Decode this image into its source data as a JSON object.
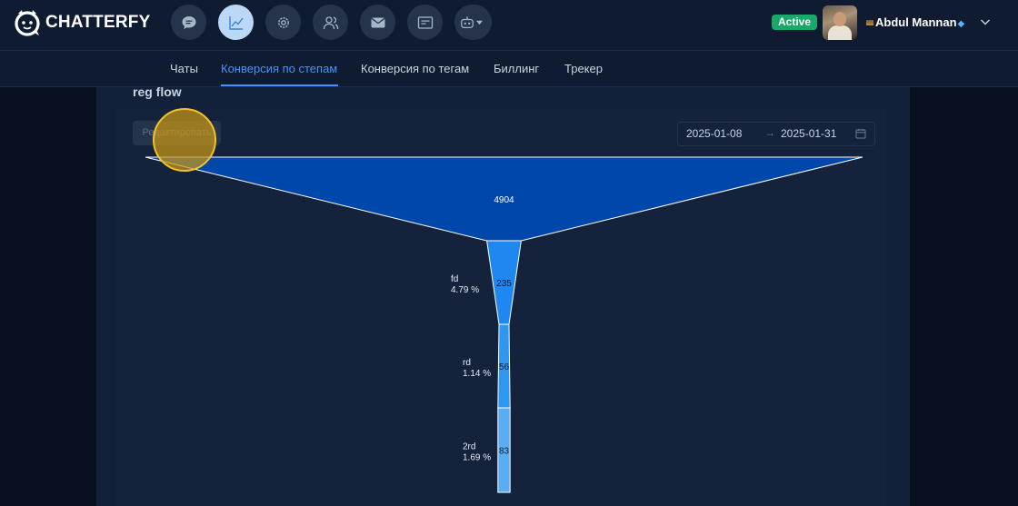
{
  "brand": {
    "name": "CHATTERFY"
  },
  "nav": {
    "icons": [
      "chat-icon",
      "analytics-icon",
      "settings-icon",
      "users-icon",
      "mail-icon",
      "broadcast-icon",
      "bot-icon"
    ],
    "active": "analytics-icon"
  },
  "user": {
    "status": "Active",
    "name": "Abdul Mannan"
  },
  "tabs": [
    {
      "label": "Чаты"
    },
    {
      "label": "Конверсия по степам",
      "active": true
    },
    {
      "label": "Конверсия по тегам"
    },
    {
      "label": "Биллинг"
    },
    {
      "label": "Трекер"
    }
  ],
  "flow": {
    "title": "reg flow",
    "edit_label": "Редактировать",
    "date_from": "2025-01-08",
    "date_to": "2025-01-31",
    "date_separator": "→"
  },
  "colors": {
    "accent": "#4a90ff",
    "status_active": "#18a86a",
    "funnel_1": "#0047ab",
    "funnel_2": "#1e88f0",
    "funnel_3": "#2f97f0",
    "funnel_4": "#5aadf2"
  },
  "chart_data": {
    "type": "funnel",
    "stages": [
      {
        "label": "",
        "value": 4904,
        "percent": ""
      },
      {
        "label": "fd",
        "value": 235,
        "percent": "4.79 %"
      },
      {
        "label": "rd",
        "value": 56,
        "percent": "1.14 %"
      },
      {
        "label": "2rd",
        "value": 83,
        "percent": "1.69 %"
      }
    ]
  }
}
